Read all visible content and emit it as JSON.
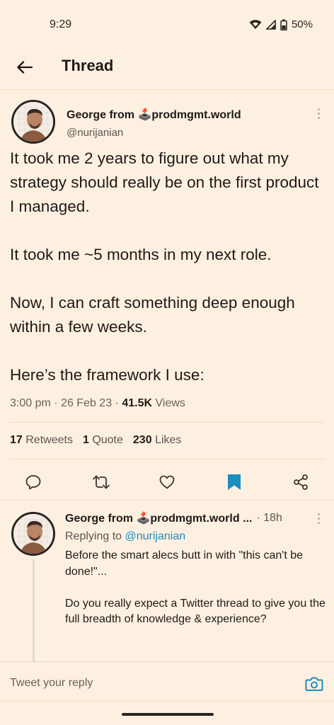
{
  "status_bar": {
    "time": "9:29",
    "battery": "50%"
  },
  "header": {
    "title": "Thread"
  },
  "main_tweet": {
    "author_name": "George from 🕹️prodmgmt.world",
    "author_handle": "@nurijanian",
    "body": [
      "It took me 2 years to figure out what my strategy should really be on the first product I managed.",
      "It took me ~5 months in my next role.",
      "Now, I can craft something deep enough within a few weeks.",
      "Here’s the framework I use:"
    ],
    "time": "3:00 pm",
    "date": "26 Feb 23",
    "views_count": "41.5K",
    "views_label": "Views",
    "retweets_count": "17",
    "retweets_label": "Retweets",
    "quotes_count": "1",
    "quotes_label": "Quote",
    "likes_count": "230",
    "likes_label": "Likes",
    "actions": [
      "reply",
      "retweet",
      "like",
      "bookmark",
      "share"
    ],
    "bookmarked": true
  },
  "reply_tweet": {
    "author_name": "George from 🕹️prodmgmt.world ...",
    "age": "18h",
    "replying_label": "Replying to",
    "replying_to": "@nurijanian",
    "body": [
      "Before the smart alecs butt in with \"this can't be done!\"...",
      "Do you really expect a Twitter thread to give you the full breadth of knowledge & experience?"
    ]
  },
  "composer": {
    "placeholder": "Tweet your reply"
  },
  "colors": {
    "background": "#fdf0e1",
    "accent": "#1d8dbf",
    "text": "#1f1a17",
    "muted": "#5d5550"
  }
}
